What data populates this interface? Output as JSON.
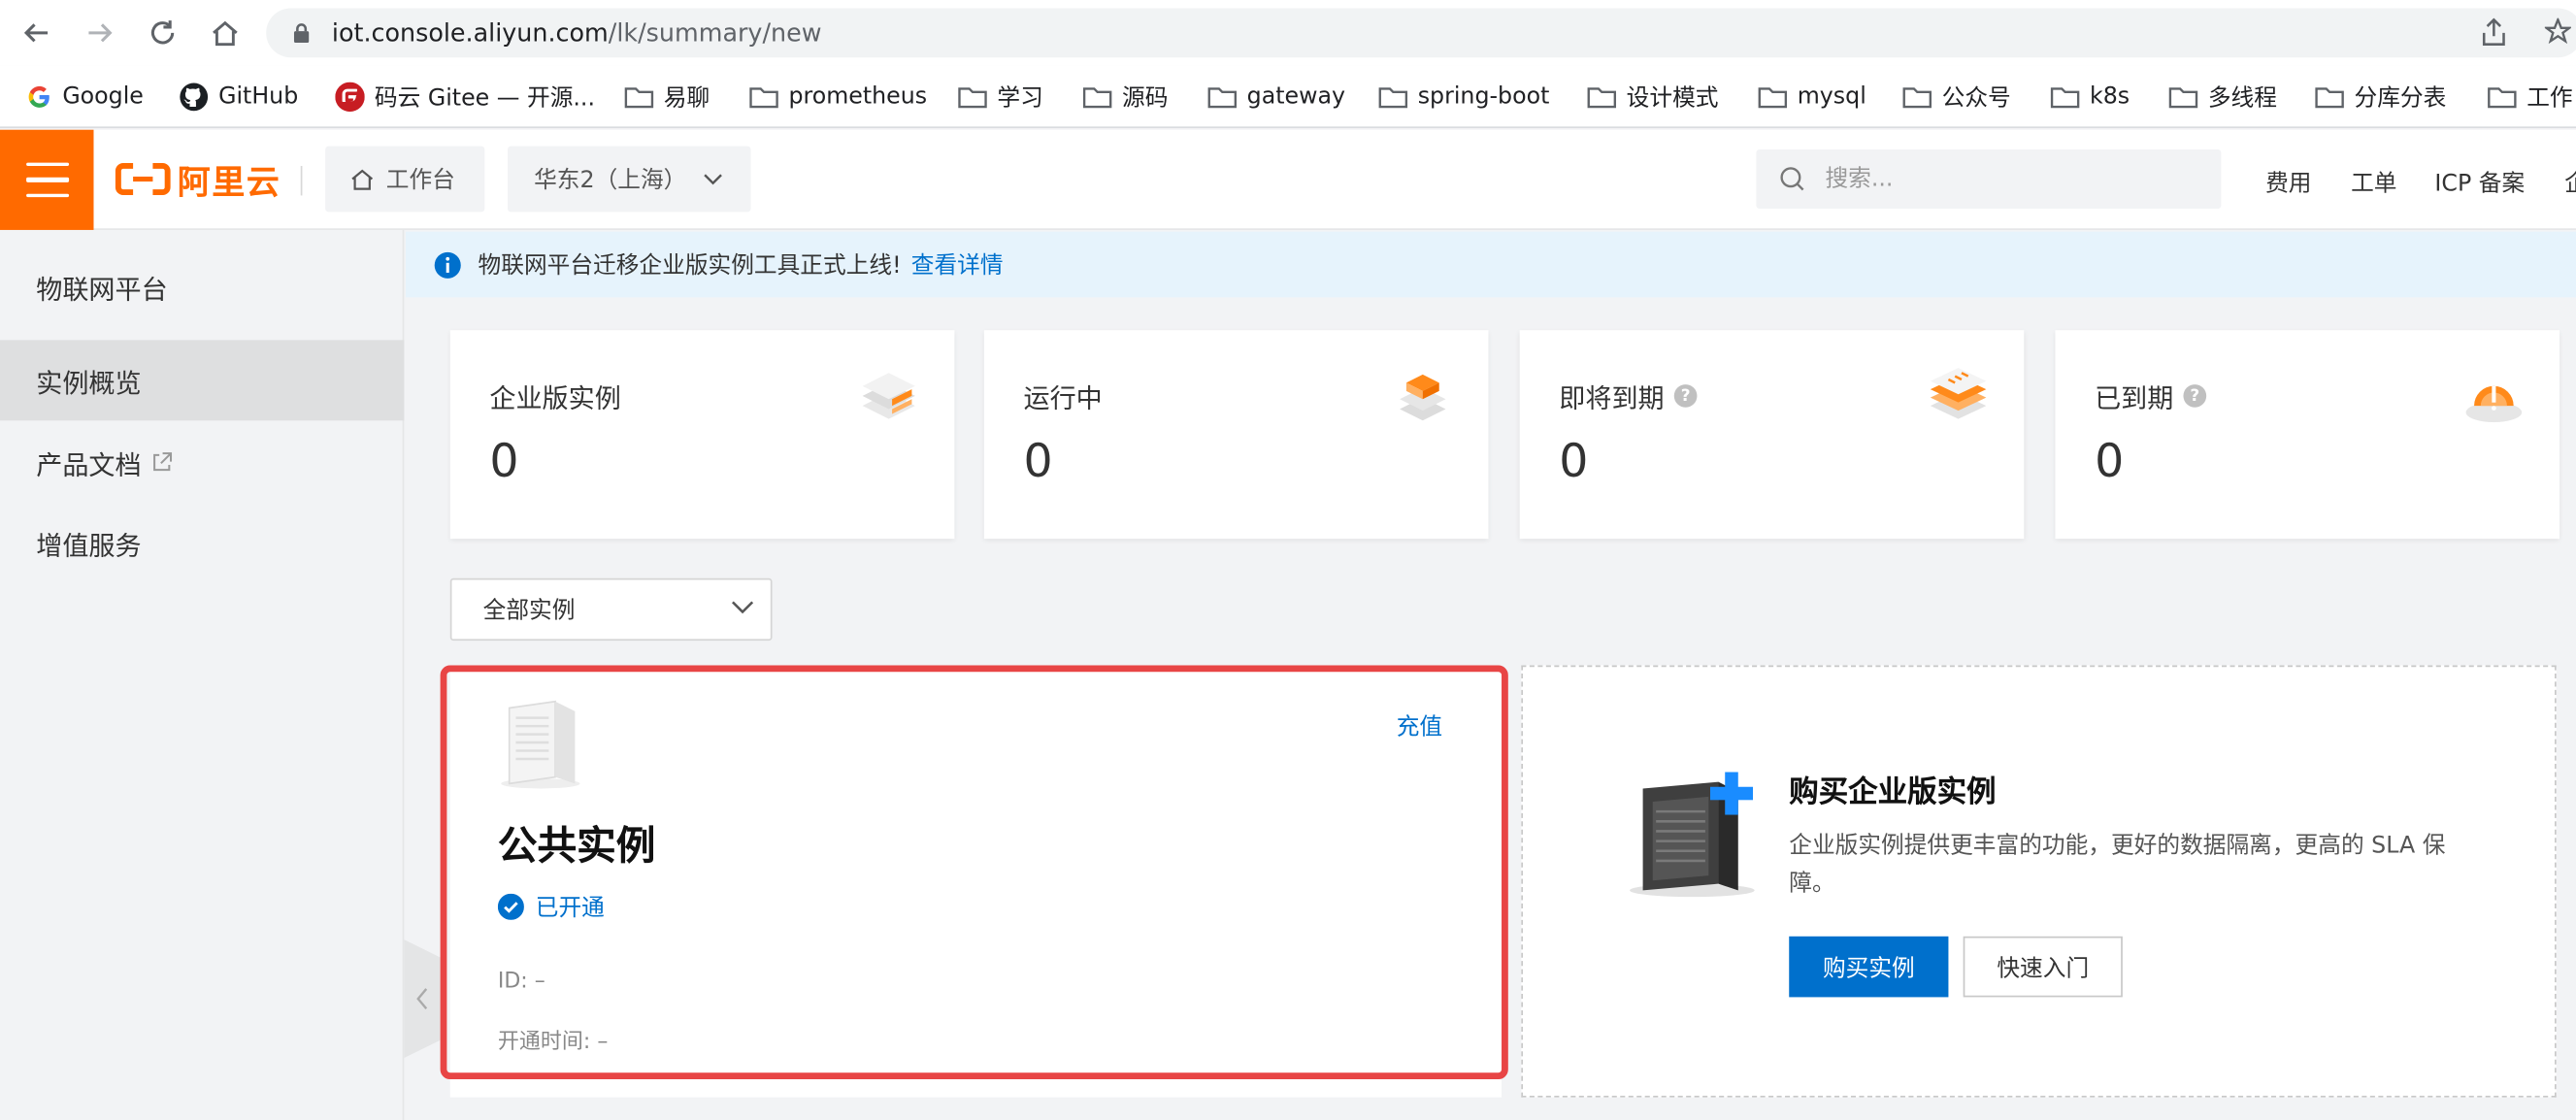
{
  "browser": {
    "url_host": "iot.console.aliyun.com",
    "url_path": "/lk/summary/new",
    "bookmarks": [
      "Google",
      "GitHub",
      "码云 Gitee — 开源...",
      "易聊",
      "prometheus",
      "学习",
      "源码",
      "gateway",
      "spring-boot",
      "设计模式",
      "mysql",
      "公众号",
      "k8s",
      "多线程",
      "分库分表",
      "工作"
    ]
  },
  "header": {
    "logo_text": "阿里云",
    "workbench": "工作台",
    "region": "华东2（上海）",
    "search_placeholder": "搜索...",
    "links": [
      "费用",
      "工单",
      "ICP 备案",
      "企"
    ]
  },
  "sidebar": {
    "title": "物联网平台",
    "items": [
      {
        "label": "实例概览",
        "active": true
      },
      {
        "label": "产品文档",
        "external": true
      },
      {
        "label": "增值服务"
      }
    ]
  },
  "notice": {
    "text": "物联网平台迁移企业版实例工具正式上线!",
    "link": "查看详情"
  },
  "stats": [
    {
      "label": "企业版实例",
      "value": "0",
      "help": false,
      "icon": "enterprise-stack-icon"
    },
    {
      "label": "运行中",
      "value": "0",
      "help": false,
      "icon": "running-stack-icon"
    },
    {
      "label": "即将到期",
      "value": "0",
      "help": true,
      "icon": "expiring-stack-icon"
    },
    {
      "label": "已到期",
      "value": "0",
      "help": true,
      "icon": "expired-alert-icon"
    }
  ],
  "filter": {
    "selected": "全部实例"
  },
  "public_instance": {
    "title": "公共实例",
    "action": "充值",
    "status": "已开通",
    "id_label": "ID:",
    "id_value": "–",
    "open_time_label": "开通时间:",
    "open_time_value": "–"
  },
  "buy_card": {
    "title": "购买企业版实例",
    "description": "企业版实例提供更丰富的功能，更好的数据隔离，更高的 SLA 保障。",
    "primary_button": "购买实例",
    "secondary_button": "快速入门"
  },
  "colors": {
    "accent": "#ff6a00",
    "link": "#0070cc",
    "highlight": "#e84545",
    "notice_bg": "#e6f3fc"
  }
}
